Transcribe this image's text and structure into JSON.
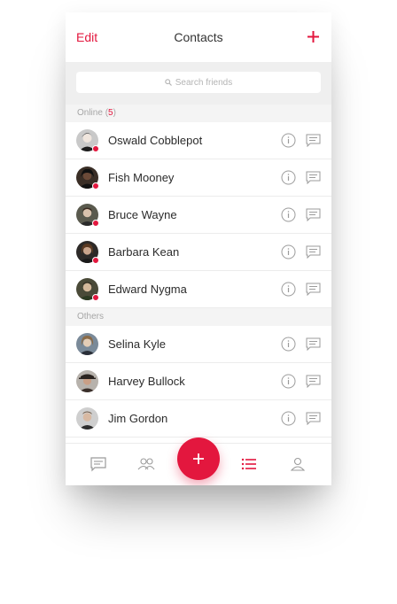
{
  "header": {
    "edit_label": "Edit",
    "title": "Contacts",
    "add_icon": "plus-icon"
  },
  "search": {
    "placeholder": "Search friends",
    "icon": "search-icon"
  },
  "online_section": {
    "label": "Online",
    "count": "5"
  },
  "online_contacts": [
    {
      "name": "Oswald Cobblepot",
      "status": "online"
    },
    {
      "name": "Fish Mooney",
      "status": "online"
    },
    {
      "name": "Bruce Wayne",
      "status": "online"
    },
    {
      "name": "Barbara Kean",
      "status": "online"
    },
    {
      "name": "Edward Nygma",
      "status": "online"
    }
  ],
  "others_section": {
    "label": "Others"
  },
  "other_contacts": [
    {
      "name": "Selina Kyle"
    },
    {
      "name": "Harvey Bullock"
    },
    {
      "name": "Jim Gordon"
    }
  ],
  "row_icons": [
    "info-icon",
    "chat-icon"
  ],
  "tabbar": {
    "tabs": [
      "chat-icon",
      "people-icon",
      "add-icon",
      "list-icon",
      "profile-icon"
    ],
    "active": "list-icon"
  },
  "colors": {
    "accent": "#e3173e",
    "online_dot": "#e3173e",
    "section_bg": "#f4f4f4"
  }
}
